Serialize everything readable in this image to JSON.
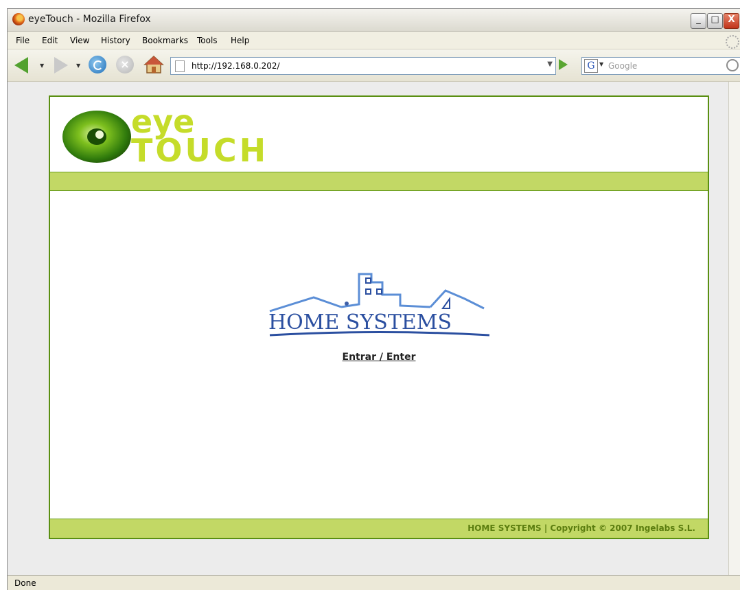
{
  "window": {
    "title": "eyeTouch - Mozilla Firefox",
    "minimize_glyph": "_",
    "maximize_glyph": "□",
    "close_glyph": "X"
  },
  "menu": {
    "items": [
      "File",
      "Edit",
      "View",
      "History",
      "Bookmarks",
      "Tools",
      "Help"
    ]
  },
  "toolbar": {
    "url": "http://192.168.0.202/",
    "search_engine_letter": "G",
    "search_placeholder": "Google",
    "icons": [
      "back-icon",
      "forward-icon",
      "reload-icon",
      "stop-icon",
      "home-icon",
      "page-icon",
      "go-icon",
      "search-magnifier-icon"
    ]
  },
  "site": {
    "logo_line1": "eye",
    "logo_line2": "TOUCH",
    "brand_logo_text": "HOME SYSTEMS",
    "enter_link": "Entrar / Enter",
    "footer": "HOME SYSTEMS | Copyright © 2007 Ingelabs S.L.",
    "colors": {
      "accent_green": "#c2d865",
      "border_green": "#5a8f12",
      "logo_blue": "#2b4fa0"
    }
  },
  "status": {
    "text": "Done"
  }
}
